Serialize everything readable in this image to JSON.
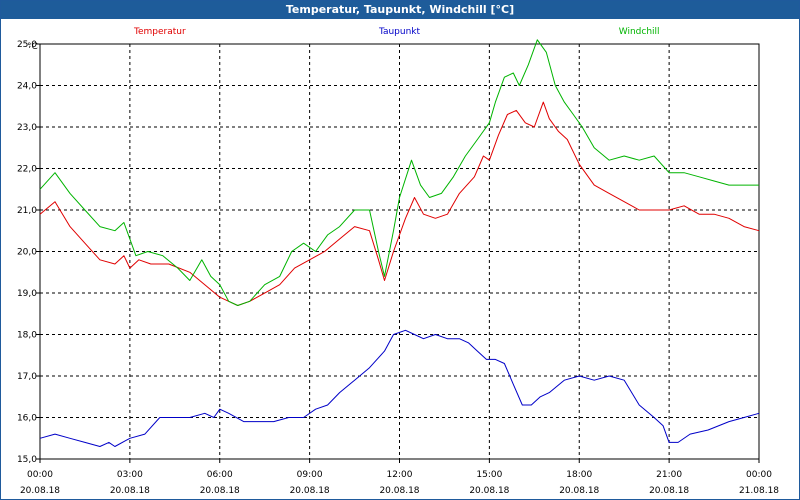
{
  "window": {
    "title": "Temperatur, Taupunkt, Windchill [°C]"
  },
  "chart_data": {
    "type": "line",
    "title": "Temperatur, Taupunkt, Windchill [°C]",
    "ylabel": "°C",
    "ylim": [
      15.0,
      25.0
    ],
    "xlim": [
      0,
      24
    ],
    "grid": true,
    "legend_position": "top",
    "y_ticks": [
      "15,0",
      "16,0",
      "17,0",
      "18,0",
      "19,0",
      "20,0",
      "21,0",
      "22,0",
      "23,0",
      "24,0",
      "25,0"
    ],
    "x_ticks": [
      {
        "time": "00:00",
        "date": "20.08.18"
      },
      {
        "time": "03:00",
        "date": "20.08.18"
      },
      {
        "time": "06:00",
        "date": "20.08.18"
      },
      {
        "time": "09:00",
        "date": "20.08.18"
      },
      {
        "time": "12:00",
        "date": "20.08.18"
      },
      {
        "time": "15:00",
        "date": "20.08.18"
      },
      {
        "time": "18:00",
        "date": "20.08.18"
      },
      {
        "time": "21:00",
        "date": "20.08.18"
      },
      {
        "time": "00:00",
        "date": "21.08.18"
      }
    ],
    "series": [
      {
        "name": "Temperatur",
        "color": "#e00000",
        "points": [
          [
            0,
            20.9
          ],
          [
            0.5,
            21.2
          ],
          [
            1,
            20.6
          ],
          [
            1.5,
            20.2
          ],
          [
            2,
            19.8
          ],
          [
            2.5,
            19.7
          ],
          [
            2.8,
            19.9
          ],
          [
            3,
            19.6
          ],
          [
            3.3,
            19.8
          ],
          [
            3.7,
            19.7
          ],
          [
            4.3,
            19.7
          ],
          [
            5,
            19.5
          ],
          [
            5.5,
            19.2
          ],
          [
            6,
            18.9
          ],
          [
            6.3,
            18.8
          ],
          [
            6.6,
            18.7
          ],
          [
            7,
            18.8
          ],
          [
            7.5,
            19.0
          ],
          [
            8,
            19.2
          ],
          [
            8.5,
            19.6
          ],
          [
            9,
            19.8
          ],
          [
            9.5,
            20.0
          ],
          [
            10,
            20.3
          ],
          [
            10.5,
            20.6
          ],
          [
            11,
            20.5
          ],
          [
            11.3,
            19.8
          ],
          [
            11.5,
            19.3
          ],
          [
            11.8,
            20.0
          ],
          [
            12.2,
            20.8
          ],
          [
            12.5,
            21.3
          ],
          [
            12.8,
            20.9
          ],
          [
            13.2,
            20.8
          ],
          [
            13.6,
            20.9
          ],
          [
            14,
            21.4
          ],
          [
            14.5,
            21.8
          ],
          [
            14.8,
            22.3
          ],
          [
            15,
            22.2
          ],
          [
            15.3,
            22.8
          ],
          [
            15.6,
            23.3
          ],
          [
            15.9,
            23.4
          ],
          [
            16.2,
            23.1
          ],
          [
            16.5,
            23.0
          ],
          [
            16.8,
            23.6
          ],
          [
            17,
            23.2
          ],
          [
            17.3,
            22.9
          ],
          [
            17.6,
            22.7
          ],
          [
            18,
            22.1
          ],
          [
            18.5,
            21.6
          ],
          [
            19,
            21.4
          ],
          [
            19.5,
            21.2
          ],
          [
            20,
            21.0
          ],
          [
            20.5,
            21.0
          ],
          [
            21,
            21.0
          ],
          [
            21.5,
            21.1
          ],
          [
            22,
            20.9
          ],
          [
            22.5,
            20.9
          ],
          [
            23,
            20.8
          ],
          [
            23.5,
            20.6
          ],
          [
            24,
            20.5
          ]
        ]
      },
      {
        "name": "Taupunkt",
        "color": "#0000c8",
        "points": [
          [
            0,
            15.5
          ],
          [
            0.5,
            15.6
          ],
          [
            1,
            15.5
          ],
          [
            1.5,
            15.4
          ],
          [
            2,
            15.3
          ],
          [
            2.3,
            15.4
          ],
          [
            2.5,
            15.3
          ],
          [
            3,
            15.5
          ],
          [
            3.5,
            15.6
          ],
          [
            4,
            16.0
          ],
          [
            4.5,
            16.0
          ],
          [
            5,
            16.0
          ],
          [
            5.5,
            16.1
          ],
          [
            5.8,
            16.0
          ],
          [
            6,
            16.2
          ],
          [
            6.3,
            16.1
          ],
          [
            6.8,
            15.9
          ],
          [
            7.3,
            15.9
          ],
          [
            7.8,
            15.9
          ],
          [
            8.3,
            16.0
          ],
          [
            8.8,
            16.0
          ],
          [
            9.2,
            16.2
          ],
          [
            9.6,
            16.3
          ],
          [
            10,
            16.6
          ],
          [
            10.5,
            16.9
          ],
          [
            11,
            17.2
          ],
          [
            11.5,
            17.6
          ],
          [
            11.8,
            18.0
          ],
          [
            12.2,
            18.1
          ],
          [
            12.5,
            18.0
          ],
          [
            12.8,
            17.9
          ],
          [
            13.2,
            18.0
          ],
          [
            13.6,
            17.9
          ],
          [
            14,
            17.9
          ],
          [
            14.3,
            17.8
          ],
          [
            14.6,
            17.6
          ],
          [
            14.9,
            17.4
          ],
          [
            15.2,
            17.4
          ],
          [
            15.5,
            17.3
          ],
          [
            15.8,
            16.8
          ],
          [
            16.1,
            16.3
          ],
          [
            16.4,
            16.3
          ],
          [
            16.7,
            16.5
          ],
          [
            17,
            16.6
          ],
          [
            17.5,
            16.9
          ],
          [
            18,
            17.0
          ],
          [
            18.5,
            16.9
          ],
          [
            19,
            17.0
          ],
          [
            19.5,
            16.9
          ],
          [
            20,
            16.3
          ],
          [
            20.5,
            16.0
          ],
          [
            20.8,
            15.8
          ],
          [
            21,
            15.4
          ],
          [
            21.3,
            15.4
          ],
          [
            21.7,
            15.6
          ],
          [
            22.3,
            15.7
          ],
          [
            23,
            15.9
          ],
          [
            23.5,
            16.0
          ],
          [
            24,
            16.1
          ]
        ]
      },
      {
        "name": "Windchill",
        "color": "#00b400",
        "points": [
          [
            0,
            21.5
          ],
          [
            0.5,
            21.9
          ],
          [
            1,
            21.4
          ],
          [
            1.5,
            21.0
          ],
          [
            2,
            20.6
          ],
          [
            2.5,
            20.5
          ],
          [
            2.8,
            20.7
          ],
          [
            3.2,
            19.9
          ],
          [
            3.6,
            20.0
          ],
          [
            4.1,
            19.9
          ],
          [
            4.6,
            19.6
          ],
          [
            5,
            19.3
          ],
          [
            5.4,
            19.8
          ],
          [
            5.7,
            19.4
          ],
          [
            6,
            19.2
          ],
          [
            6.3,
            18.8
          ],
          [
            6.6,
            18.7
          ],
          [
            7,
            18.8
          ],
          [
            7.5,
            19.2
          ],
          [
            8,
            19.4
          ],
          [
            8.4,
            20.0
          ],
          [
            8.8,
            20.2
          ],
          [
            9.2,
            20.0
          ],
          [
            9.6,
            20.4
          ],
          [
            10,
            20.6
          ],
          [
            10.5,
            21.0
          ],
          [
            11,
            21.0
          ],
          [
            11.3,
            20.0
          ],
          [
            11.5,
            19.4
          ],
          [
            11.8,
            20.5
          ],
          [
            12,
            21.3
          ],
          [
            12.4,
            22.2
          ],
          [
            12.7,
            21.6
          ],
          [
            13,
            21.3
          ],
          [
            13.4,
            21.4
          ],
          [
            13.8,
            21.8
          ],
          [
            14.2,
            22.3
          ],
          [
            14.6,
            22.7
          ],
          [
            15,
            23.1
          ],
          [
            15.2,
            23.6
          ],
          [
            15.5,
            24.2
          ],
          [
            15.8,
            24.3
          ],
          [
            16,
            24.0
          ],
          [
            16.3,
            24.5
          ],
          [
            16.6,
            25.1
          ],
          [
            16.9,
            24.8
          ],
          [
            17.2,
            24.0
          ],
          [
            17.5,
            23.6
          ],
          [
            17.8,
            23.3
          ],
          [
            18.1,
            23.0
          ],
          [
            18.5,
            22.5
          ],
          [
            19,
            22.2
          ],
          [
            19.5,
            22.3
          ],
          [
            20,
            22.2
          ],
          [
            20.5,
            22.3
          ],
          [
            21,
            21.9
          ],
          [
            21.5,
            21.9
          ],
          [
            22,
            21.8
          ],
          [
            22.5,
            21.7
          ],
          [
            23,
            21.6
          ],
          [
            23.5,
            21.6
          ],
          [
            24,
            21.6
          ]
        ]
      }
    ]
  }
}
